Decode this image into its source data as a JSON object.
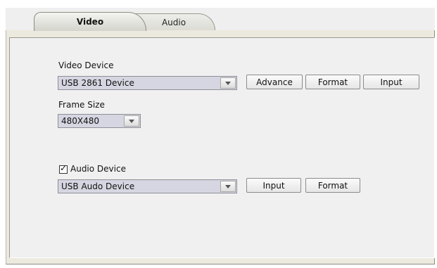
{
  "tabs": [
    {
      "label": "Video",
      "selected": true
    },
    {
      "label": "Audio",
      "selected": false
    }
  ],
  "video": {
    "device_label": "Video Device",
    "device_value": "USB 2861 Device",
    "advance_label": "Advance",
    "format_label": "Format",
    "input_label": "Input",
    "frame_size_label": "Frame Size",
    "frame_size_value": "480X480"
  },
  "audio": {
    "checkbox_checked": true,
    "device_label": "Audio Device",
    "device_value": "USB Audo Device",
    "input_label": "Input",
    "format_label": "Format"
  }
}
